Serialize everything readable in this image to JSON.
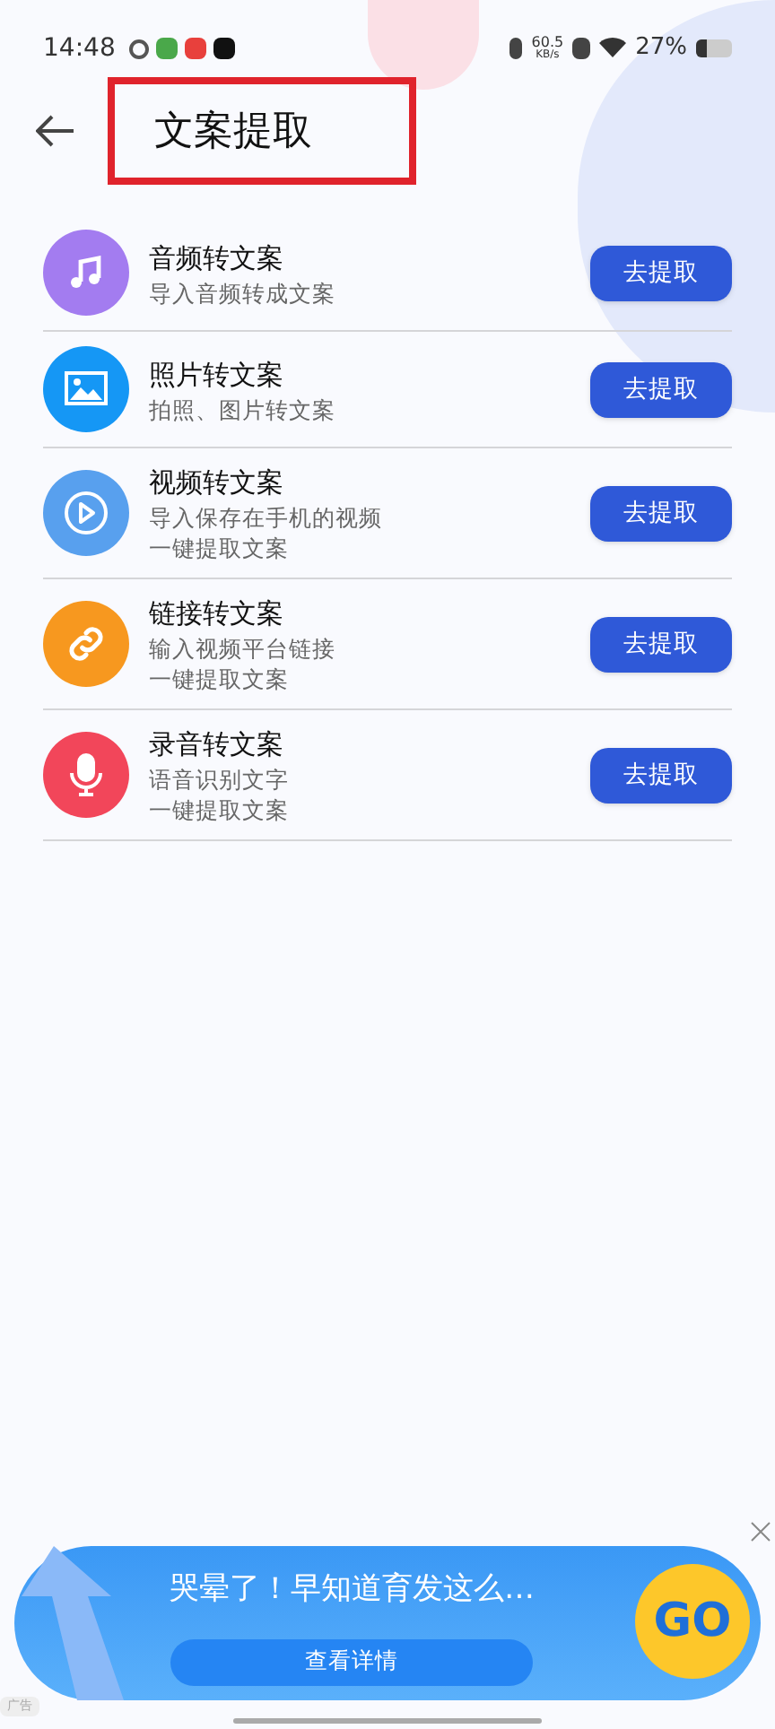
{
  "status_bar": {
    "time": "14:48",
    "speed_value": "60.5",
    "speed_unit": "KB/s",
    "battery": "27%"
  },
  "header": {
    "title": "文案提取"
  },
  "items": [
    {
      "kind": "audio",
      "title": "音频转文案",
      "lines": [
        "导入音频转成文案"
      ],
      "button": "去提取",
      "color": "#a37cf0"
    },
    {
      "kind": "photo",
      "title": "照片转文案",
      "lines": [
        "拍照、图片转文案"
      ],
      "button": "去提取",
      "color": "#1597f5"
    },
    {
      "kind": "video",
      "title": "视频转文案",
      "lines": [
        "导入保存在手机的视频",
        "一键提取文案"
      ],
      "button": "去提取",
      "color": "#58a0ee"
    },
    {
      "kind": "link",
      "title": "链接转文案",
      "lines": [
        "输入视频平台链接",
        "一键提取文案"
      ],
      "button": "去提取",
      "color": "#f7981f"
    },
    {
      "kind": "record",
      "title": "录音转文案",
      "lines": [
        "语音识别文字",
        "一键提取文案"
      ],
      "button": "去提取",
      "color": "#f2465a"
    }
  ],
  "ad": {
    "headline": "哭晕了！早知道育发这么…",
    "button": "查看详情",
    "badge": "GO",
    "label": "广告"
  }
}
